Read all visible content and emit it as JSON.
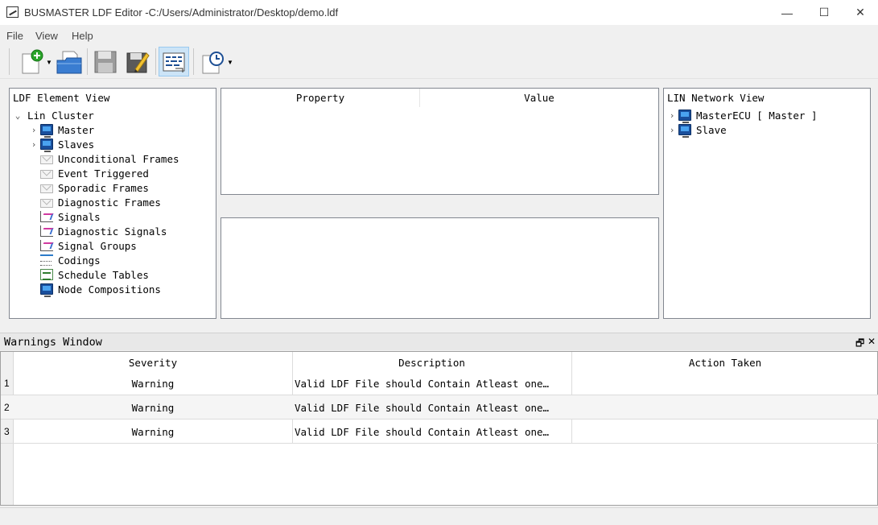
{
  "window": {
    "title": "BUSMASTER LDF Editor -C:/Users/Administrator/Desktop/demo.ldf",
    "minimize": "—",
    "maximize": "☐",
    "close": "✕"
  },
  "menu": [
    "File",
    "View",
    "Help"
  ],
  "toolbar": {
    "buttons": [
      "new-file",
      "open-file",
      "save-file",
      "save-as",
      "ldf-view",
      "schedule"
    ]
  },
  "element_view": {
    "header": "LDF Element View",
    "root": "Lin Cluster",
    "items": [
      {
        "label": "Master",
        "icon": "monitor-icon",
        "expandable": true
      },
      {
        "label": "Slaves",
        "icon": "monitor-icon",
        "expandable": true
      },
      {
        "label": "Unconditional Frames",
        "icon": "envelope-icon",
        "expandable": false
      },
      {
        "label": "Event Triggered",
        "icon": "envelope-icon",
        "expandable": false
      },
      {
        "label": "Sporadic Frames",
        "icon": "envelope-icon",
        "expandable": false
      },
      {
        "label": "Diagnostic Frames",
        "icon": "envelope-icon",
        "expandable": false
      },
      {
        "label": "Signals",
        "icon": "signal-icon",
        "expandable": false
      },
      {
        "label": "Diagnostic Signals",
        "icon": "signal-icon",
        "expandable": false
      },
      {
        "label": "Signal Groups",
        "icon": "signal-icon",
        "expandable": false
      },
      {
        "label": "Codings",
        "icon": "coding-icon",
        "expandable": false
      },
      {
        "label": "Schedule Tables",
        "icon": "table-icon",
        "expandable": false
      },
      {
        "label": "Node Compositions",
        "icon": "monitor-icon",
        "expandable": false
      }
    ]
  },
  "property_view": {
    "columns": [
      "Property",
      "Value"
    ]
  },
  "network_view": {
    "header": "LIN Network View",
    "items": [
      {
        "label": "MasterECU [ Master ]"
      },
      {
        "label": "Slave"
      }
    ]
  },
  "warnings": {
    "title": "Warnings Window",
    "float_icon": "🗗",
    "close_icon": "✕",
    "columns": [
      "Severity",
      "Description",
      "Action Taken"
    ],
    "rows": [
      {
        "num": "1",
        "severity": "Warning",
        "description": "Valid LDF File should Contain Atleast one…",
        "action": ""
      },
      {
        "num": "2",
        "severity": "Warning",
        "description": "Valid LDF File should Contain Atleast one…",
        "action": ""
      },
      {
        "num": "3",
        "severity": "Warning",
        "description": "Valid LDF File should Contain Atleast one…",
        "action": ""
      }
    ]
  }
}
